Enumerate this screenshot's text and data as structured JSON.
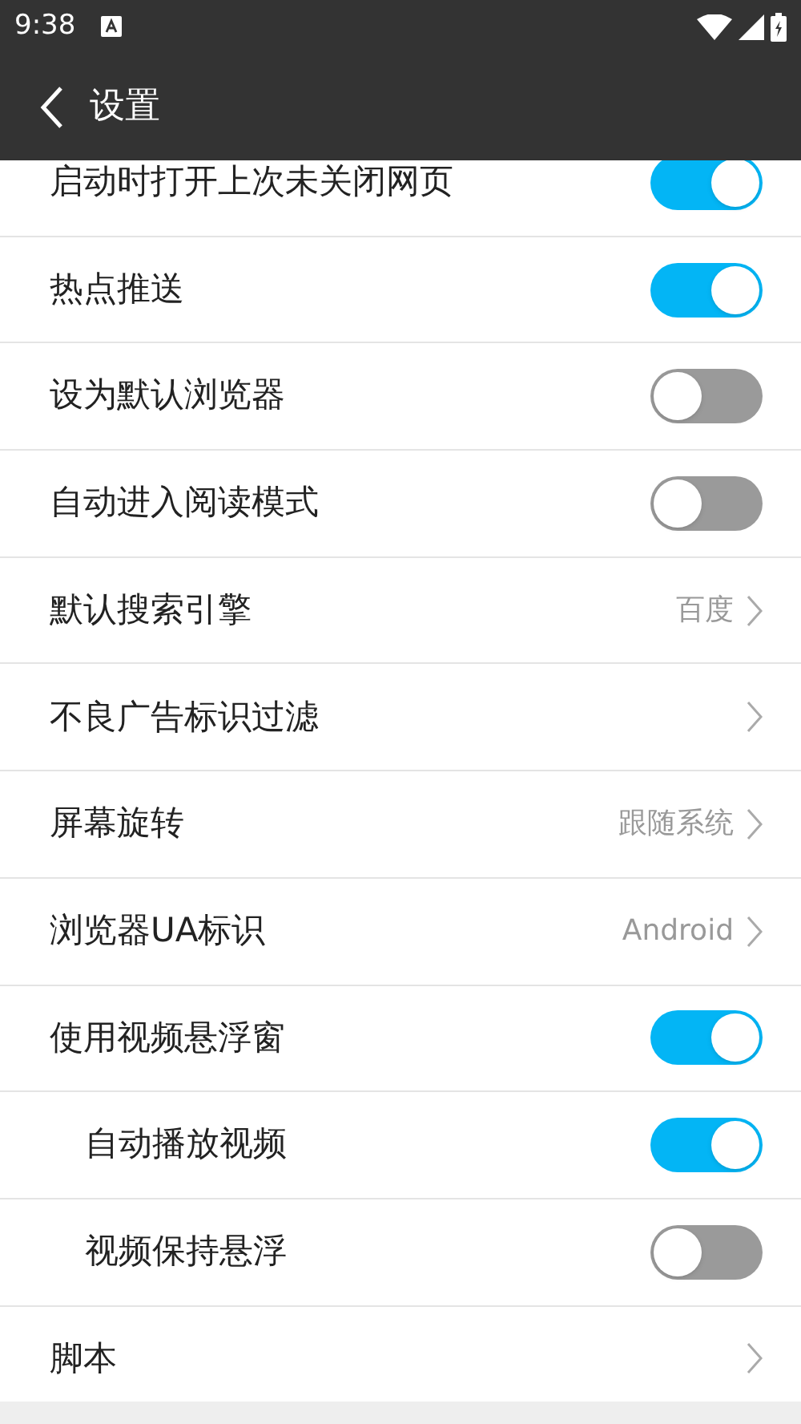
{
  "status_bar": {
    "time": "9:38"
  },
  "toolbar": {
    "title": "设置"
  },
  "settings": [
    {
      "kind": "toggle",
      "label": "启动时打开上次未关闭网页",
      "on": true,
      "indented": false
    },
    {
      "kind": "toggle",
      "label": "热点推送",
      "on": true,
      "indented": false
    },
    {
      "kind": "toggle",
      "label": "设为默认浏览器",
      "on": false,
      "indented": false
    },
    {
      "kind": "toggle",
      "label": "自动进入阅读模式",
      "on": false,
      "indented": false
    },
    {
      "kind": "link",
      "label": "默认搜索引擎",
      "value": "百度",
      "indented": false
    },
    {
      "kind": "link",
      "label": "不良广告标识过滤",
      "indented": false
    },
    {
      "kind": "link",
      "label": "屏幕旋转",
      "value": "跟随系统",
      "indented": false
    },
    {
      "kind": "link",
      "label": "浏览器UA标识",
      "value": "Android",
      "indented": false
    },
    {
      "kind": "toggle",
      "label": "使用视频悬浮窗",
      "on": true,
      "indented": false
    },
    {
      "kind": "toggle",
      "label": "自动播放视频",
      "on": true,
      "indented": true
    },
    {
      "kind": "toggle",
      "label": "视频保持悬浮",
      "on": false,
      "indented": true
    },
    {
      "kind": "link",
      "label": "脚本",
      "indented": false
    }
  ]
}
